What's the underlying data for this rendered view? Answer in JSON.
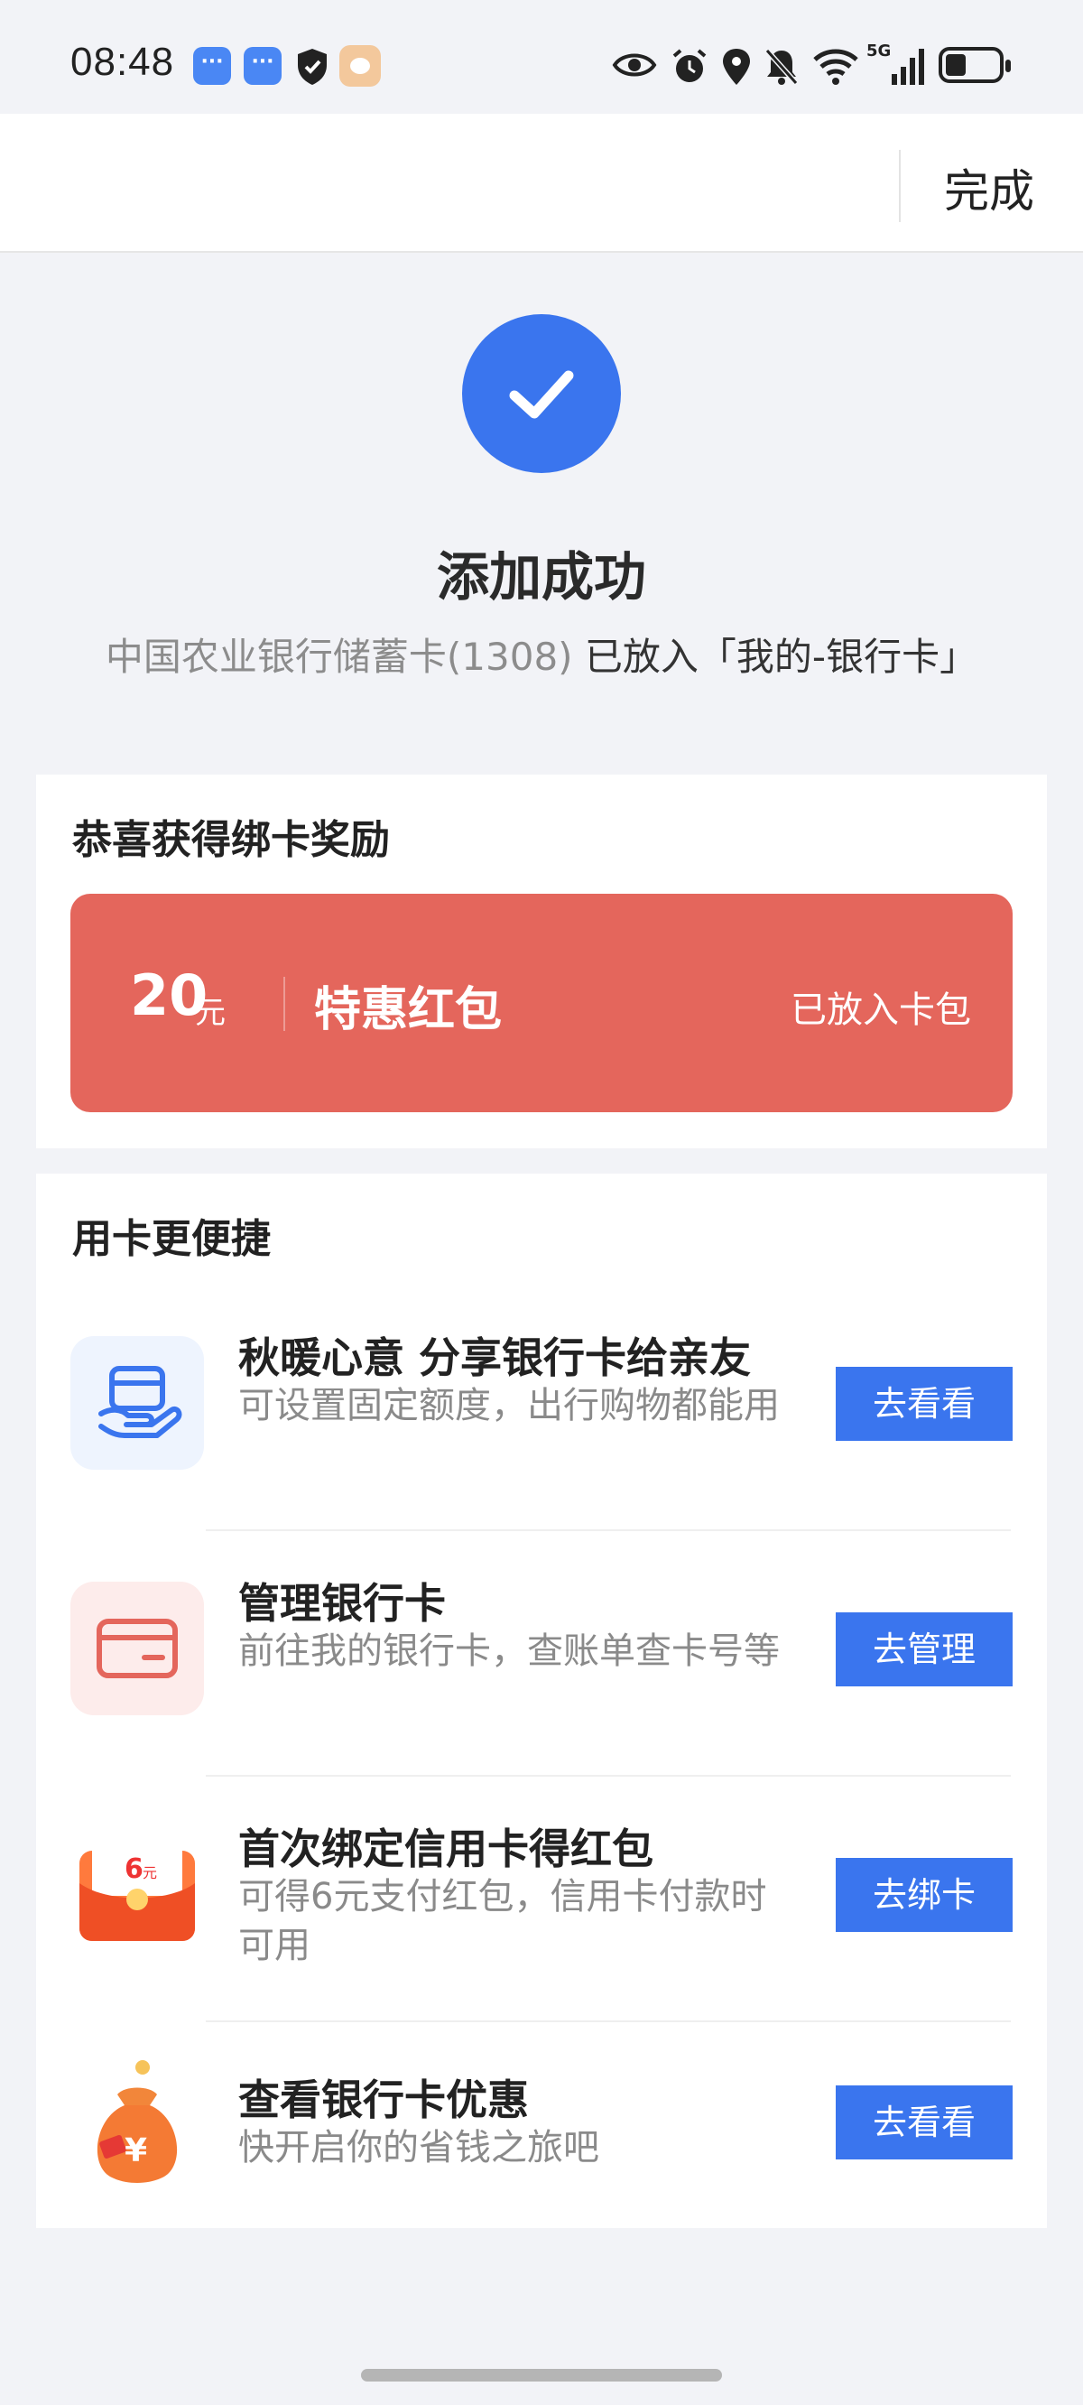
{
  "status_bar": {
    "time": "08:48",
    "network": "5G",
    "icons": [
      "message-icon",
      "message-icon",
      "shield-icon",
      "pet-app-icon",
      "eye-icon",
      "alarm-icon",
      "location-icon",
      "mute-icon",
      "wifi-icon",
      "signal-icon",
      "battery-icon"
    ]
  },
  "header": {
    "done_label": "完成"
  },
  "success": {
    "title": "添加成功",
    "subtitle_grey": "中国农业银行储蓄卡(1308)",
    "subtitle_dark": " 已放入「我的-银行卡」"
  },
  "reward": {
    "title": "恭喜获得绑卡奖励",
    "amount": "20",
    "unit": "元",
    "name": "特惠红包",
    "status": "已放入卡包"
  },
  "features": {
    "title": "用卡更便捷",
    "items": [
      {
        "title": "秋暖心意 分享银行卡给亲友",
        "desc": "可设置固定额度，出行购物都能用",
        "button": "去看看",
        "icon": "share-card-icon"
      },
      {
        "title": "管理银行卡",
        "desc": "前往我的银行卡，查账单查卡号等",
        "button": "去管理",
        "icon": "bank-card-icon"
      },
      {
        "title": "首次绑定信用卡得红包",
        "desc": "可得6元支付红包，信用卡付款时可用",
        "button": "去绑卡",
        "icon": "red-envelope-icon",
        "icon_text": "6",
        "icon_unit": "元"
      },
      {
        "title": "查看银行卡优惠",
        "desc": "快开启你的省钱之旅吧",
        "button": "去看看",
        "icon": "money-bag-icon",
        "icon_text": "¥"
      }
    ]
  },
  "colors": {
    "accent": "#3a75ee",
    "reward_red": "#e4665c",
    "background": "#f2f3f7"
  }
}
